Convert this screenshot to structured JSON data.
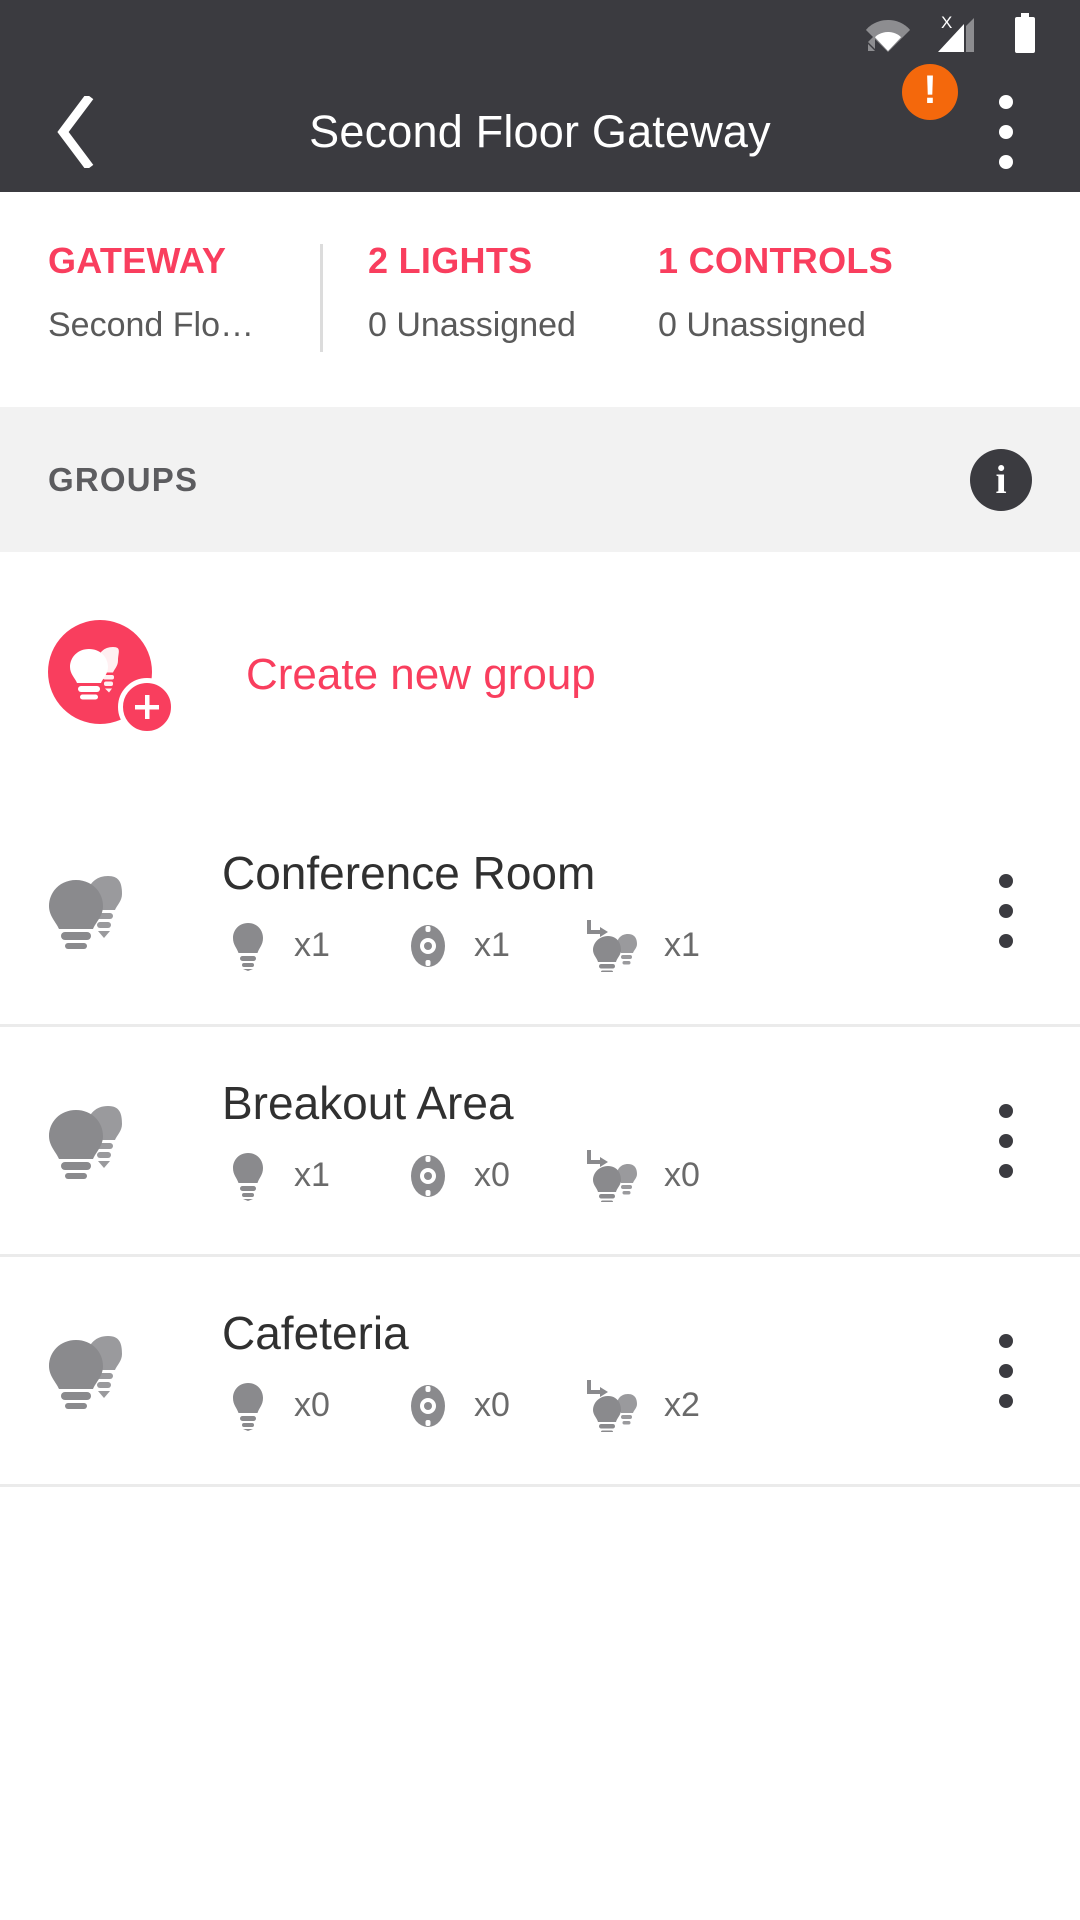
{
  "statusbar": {
    "icons": [
      {
        "name": "wifi-icon",
        "label": "wifi"
      },
      {
        "name": "cellular-no-sim-icon",
        "label": "cellular signal no service"
      },
      {
        "name": "battery-icon",
        "label": "battery"
      }
    ],
    "cellular_marker": "X"
  },
  "appbar": {
    "back_label": "‹",
    "title": "Second Floor Gateway",
    "alert_symbol": "!",
    "alert_color": "#f4680c",
    "overflow_label": "More options"
  },
  "stats": [
    {
      "title": "GATEWAY",
      "subtitle": "Second Flo…"
    },
    {
      "title": "2 LIGHTS",
      "subtitle": "0 Unassigned"
    },
    {
      "title": "1 CONTROLS",
      "subtitle": "0 Unassigned"
    }
  ],
  "groups_section": {
    "label": "GROUPS",
    "info_symbol": "i"
  },
  "create_group": {
    "label": "Create new group",
    "plus_symbol": "+"
  },
  "groups": [
    {
      "name": "Conference Room",
      "metrics": [
        {
          "icon": "light-bulb-icon",
          "count": "x1"
        },
        {
          "icon": "control-dial-icon",
          "count": "x1"
        },
        {
          "icon": "scene-assign-icon",
          "count": "x1"
        }
      ]
    },
    {
      "name": "Breakout Area",
      "metrics": [
        {
          "icon": "light-bulb-icon",
          "count": "x1"
        },
        {
          "icon": "control-dial-icon",
          "count": "x0"
        },
        {
          "icon": "scene-assign-icon",
          "count": "x0"
        }
      ]
    },
    {
      "name": "Cafeteria",
      "metrics": [
        {
          "icon": "light-bulb-icon",
          "count": "x0"
        },
        {
          "icon": "control-dial-icon",
          "count": "x0"
        },
        {
          "icon": "scene-assign-icon",
          "count": "x2"
        }
      ]
    }
  ],
  "colors": {
    "accent": "#f93e5e",
    "appbar_bg": "#3b3b40",
    "alert": "#f4680c",
    "section_bg": "#f2f2f2",
    "icon_gray": "#8a8a8d"
  }
}
